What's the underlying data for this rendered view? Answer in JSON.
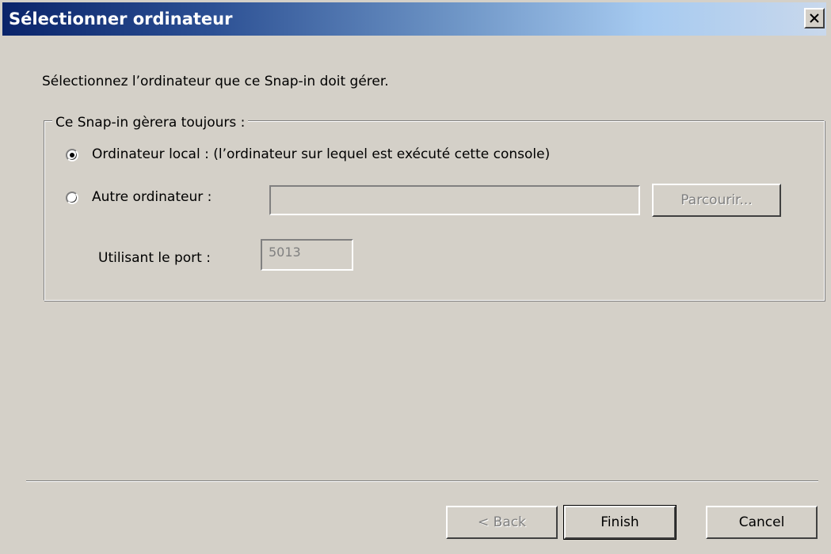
{
  "window": {
    "title": "Sélectionner ordinateur"
  },
  "dialog": {
    "instruction": "Sélectionnez l’ordinateur que ce Snap-in doit gérer.",
    "group_label": "Ce Snap-in gèrera toujours :",
    "options": [
      {
        "label": "Ordinateur local :  (l’ordinateur sur lequel est exécuté cette console)",
        "selected": true
      },
      {
        "label": "Autre ordinateur :",
        "selected": false
      }
    ],
    "computer_name_value": "",
    "browse_label": "Parcourir...",
    "port_label": "Utilisant le port :",
    "port_value": "5013"
  },
  "footer": {
    "back_label": "< Back",
    "finish_label": "Finish",
    "cancel_label": "Cancel"
  },
  "icons": {
    "close": "close-icon"
  },
  "colors": {
    "title_bar_start": "#0a246a",
    "title_bar_end": "#a6caf0",
    "window_background": "#d4d0c8",
    "disabled_text": "#808080"
  }
}
